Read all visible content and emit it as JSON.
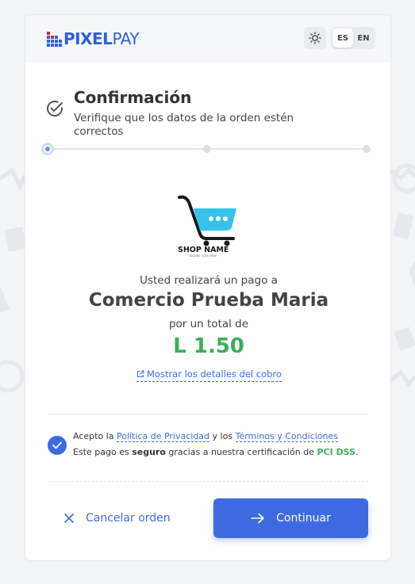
{
  "brand": {
    "name_bold": "PIXEL",
    "name_light": "PAY"
  },
  "header": {
    "theme_icon": "sun-icon",
    "languages": [
      {
        "code": "ES",
        "active": true
      },
      {
        "code": "EN",
        "active": false
      }
    ]
  },
  "step": {
    "title": "Confirmación",
    "subtitle": "Verifique que los datos de la orden estén correctos",
    "progress": {
      "total_steps": 3,
      "current_step": 1
    }
  },
  "shop": {
    "logo_text": "SHOP NAME",
    "logo_tagline": "TAGLINE GOES HERE"
  },
  "payment": {
    "intro": "Usted realizará un pago a",
    "merchant": "Comercio Prueba Maria",
    "total_label": "por un total de",
    "amount": "L 1.50",
    "details_link": "Mostrar los detalles del cobro"
  },
  "terms": {
    "checked": true,
    "accept_prefix": "Acepto la",
    "privacy_link": "Política de Privacidad",
    "connector": "y los",
    "terms_link": "Términos y Condiciones",
    "security_prefix": "Este pago es",
    "security_bold": "seguro",
    "security_middle": "gracias a nuestra certificación de",
    "security_cert": "PCI DSS",
    "security_suffix": "."
  },
  "actions": {
    "cancel_label": "Cancelar orden",
    "continue_label": "Continuar"
  },
  "colors": {
    "primary": "#3e6ae1",
    "success": "#3cae5c",
    "text": "#333333"
  }
}
